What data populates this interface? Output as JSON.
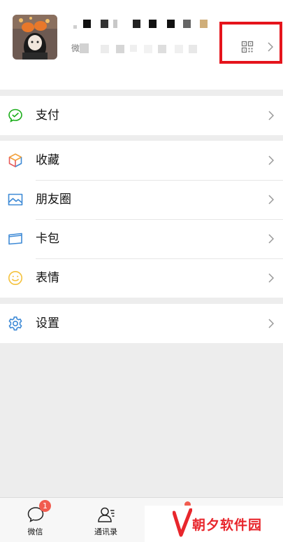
{
  "profile": {
    "nickname": "",
    "wechat_id_prefix": "微",
    "qr_icon": "qr-code-icon",
    "highlight_color": "#e5141c"
  },
  "menu": {
    "pay": {
      "label": "支付",
      "icon": "wechat-pay-icon",
      "color": "#1aad19"
    },
    "favorites": {
      "label": "收藏",
      "icon": "favorites-cube-icon"
    },
    "moments": {
      "label": "朋友圈",
      "icon": "moments-photo-icon",
      "color": "#3e8ad6"
    },
    "cards": {
      "label": "卡包",
      "icon": "card-wallet-icon",
      "color": "#3e8ad6"
    },
    "stickers": {
      "label": "表情",
      "icon": "sticker-smiley-icon",
      "color": "#f5c23c"
    },
    "settings": {
      "label": "设置",
      "icon": "settings-gear-icon",
      "color": "#3e8ad6"
    }
  },
  "tabbar": {
    "chats": {
      "label": "微信",
      "badge": "1",
      "icon": "chat-bubble-icon"
    },
    "contacts": {
      "label": "通讯录",
      "icon": "contacts-icon"
    },
    "discover": {
      "label": "",
      "icon": "discover-compass-icon",
      "has_dot": true
    },
    "me": {
      "label": "",
      "icon": "me-person-icon"
    }
  },
  "watermark": {
    "text": "朝夕软件园",
    "color": "#e8262c"
  }
}
